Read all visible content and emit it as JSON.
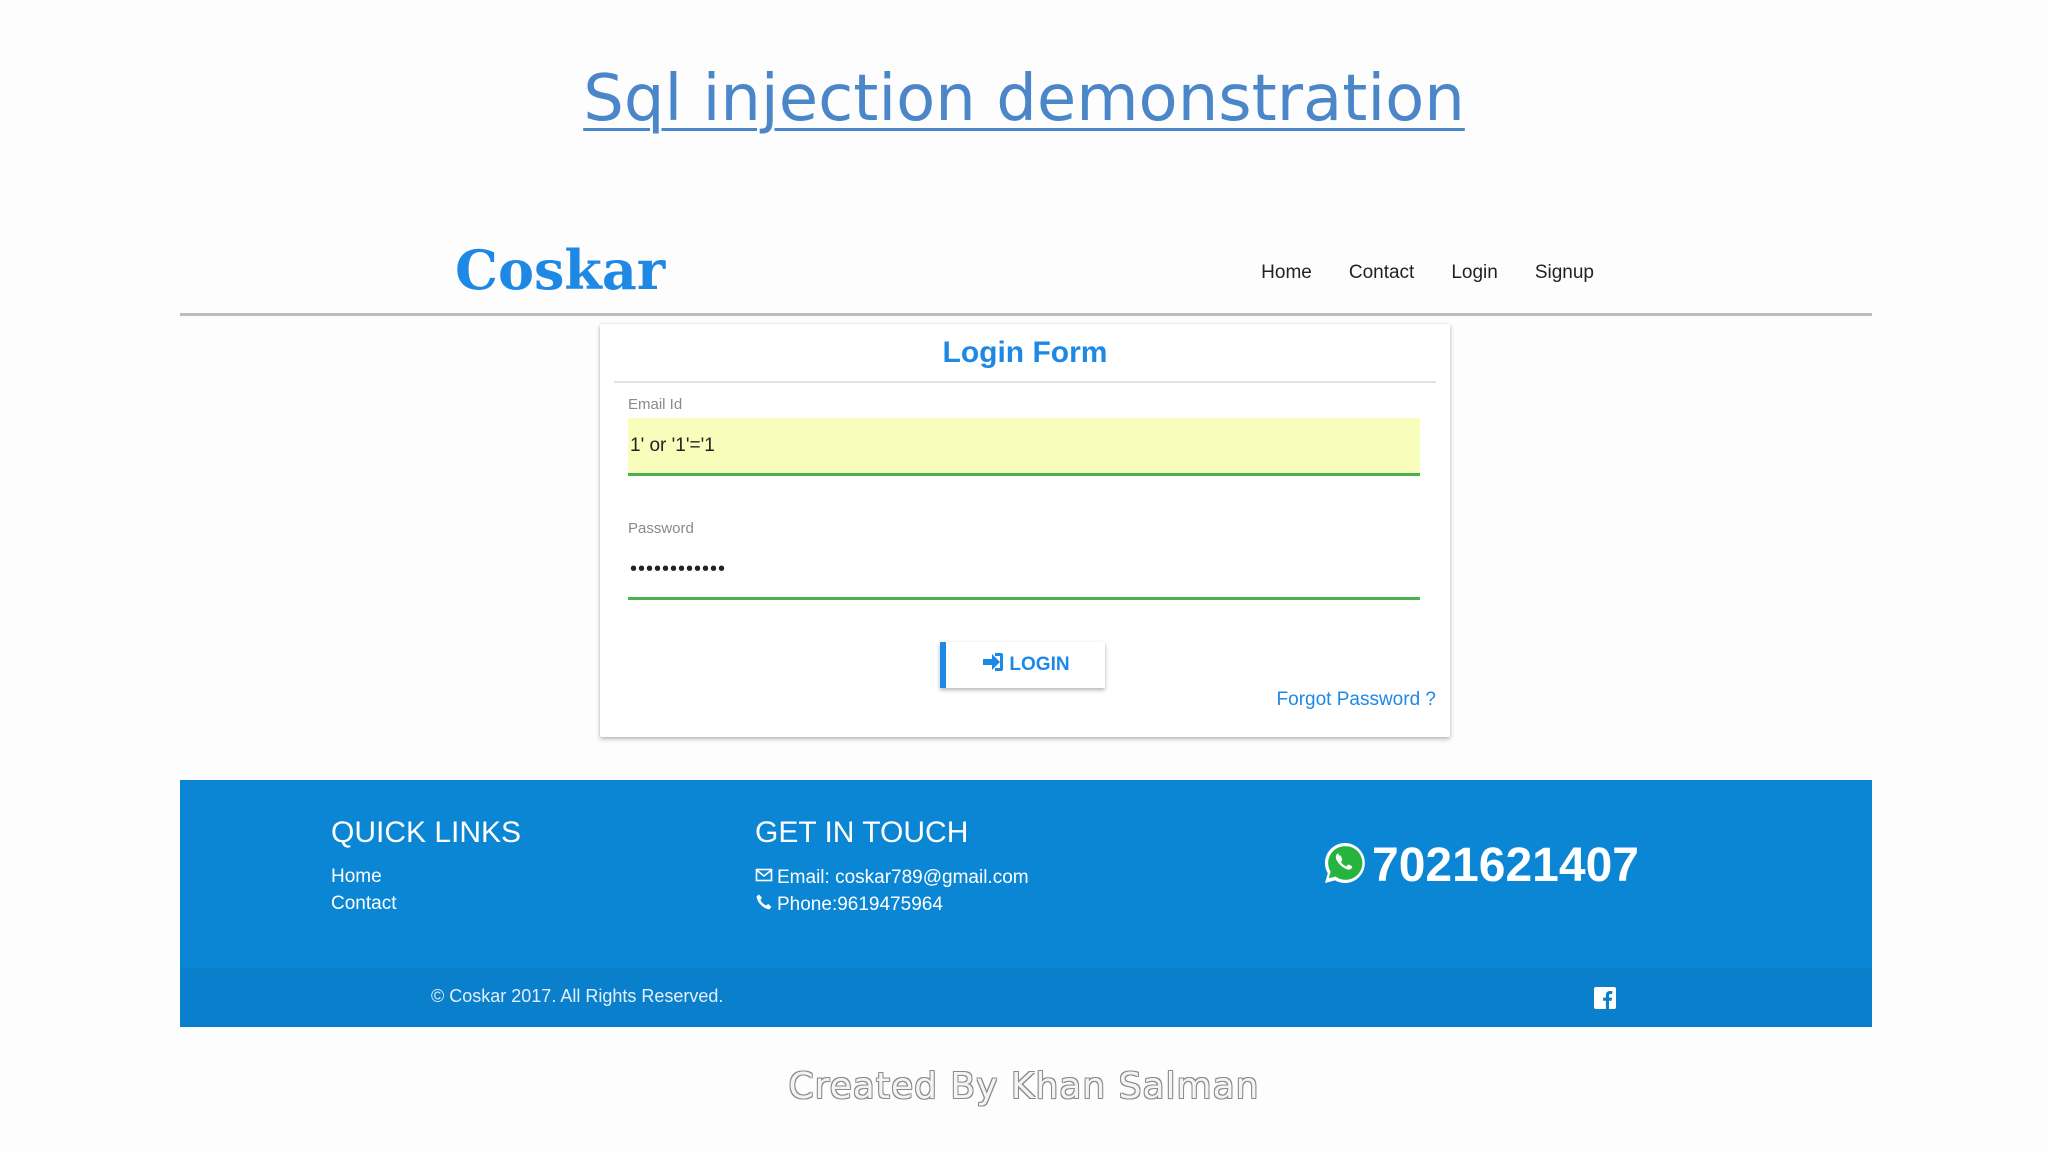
{
  "slide": {
    "title": "Sql injection demonstration",
    "credit": "Created  By Khan Salman"
  },
  "header": {
    "brand": "Coskar",
    "nav": [
      "Home",
      "Contact",
      "Login",
      "Signup"
    ]
  },
  "login_form": {
    "title": "Login Form",
    "email_label": "Email Id",
    "email_value": "1' or '1'='1",
    "password_label": "Password",
    "password_value": "••••••••••••",
    "login_button": "LOGIN",
    "forgot_password": "Forgot Password ?"
  },
  "footer": {
    "quick_links_heading": "QUICK LINKS",
    "quick_links": [
      "Home",
      "Contact"
    ],
    "get_in_touch_heading": "GET IN TOUCH",
    "email": "Email: coskar789@gmail.com",
    "phone": "Phone:9619475964",
    "whatsapp_number": "7021621407",
    "copyright": "© Coskar 2017. All Rights Reserved."
  },
  "colors": {
    "accent": "#1e88e5",
    "footer": "#0a86d4",
    "autofill": "#f9fdbb",
    "input_underline": "#4caf50"
  },
  "icons": [
    "sign-in-icon",
    "envelope-icon",
    "phone-icon",
    "whatsapp-icon",
    "facebook-icon"
  ]
}
